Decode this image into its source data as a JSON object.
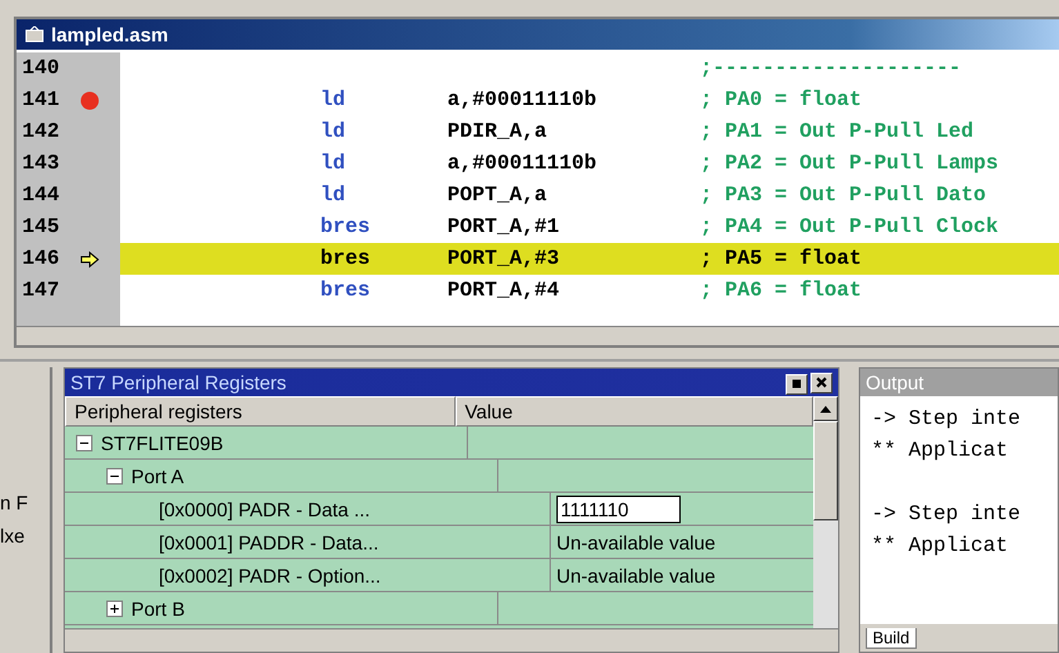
{
  "editor": {
    "title": "lampled.asm",
    "lines": [
      {
        "number": "140",
        "kind": "plain",
        "highlighted": false,
        "comment": ";--------------------"
      },
      {
        "number": "141",
        "kind": "breakpoint",
        "highlighted": false,
        "mnemonic": "ld",
        "operand": "a,#00011110b",
        "comment": "; PA0 = float"
      },
      {
        "number": "142",
        "kind": "plain",
        "highlighted": false,
        "mnemonic": "ld",
        "operand": "PDIR_A,a",
        "comment": "; PA1 = Out P-Pull Led"
      },
      {
        "number": "143",
        "kind": "plain",
        "highlighted": false,
        "mnemonic": "ld",
        "operand": "a,#00011110b",
        "comment": "; PA2 = Out P-Pull Lamps"
      },
      {
        "number": "144",
        "kind": "plain",
        "highlighted": false,
        "mnemonic": "ld",
        "operand": "POPT_A,a",
        "comment": "; PA3 = Out P-Pull Dato"
      },
      {
        "number": "145",
        "kind": "plain",
        "highlighted": false,
        "mnemonic": "bres",
        "operand": "PORT_A,#1",
        "comment": "; PA4 = Out P-Pull Clock"
      },
      {
        "number": "146",
        "kind": "current",
        "highlighted": true,
        "mnemonic": "bres",
        "operand": "PORT_A,#3",
        "comment": "; PA5 = float"
      },
      {
        "number": "147",
        "kind": "plain",
        "highlighted": false,
        "mnemonic": "bres",
        "operand": "PORT_A,#4",
        "comment": "; PA6 = float"
      }
    ]
  },
  "side_panel": {
    "texts": [
      "n F",
      "lxe"
    ]
  },
  "registers": {
    "title": "Peripheral Registers",
    "title_prefix": "ST7",
    "columns": [
      "Peripheral registers",
      "Value"
    ],
    "tree": [
      {
        "label": "ST7FLITE09B",
        "expanded": true,
        "children": [
          {
            "label": "Port A",
            "expanded": true,
            "children": [
              {
                "label": "[0x0000] PADR - Data ...",
                "value": "1111110",
                "editing": true
              },
              {
                "label": "[0x0001] PADDR - Data...",
                "value": "Un-available value",
                "editing": false
              },
              {
                "label": "[0x0002] PADR - Option...",
                "value": "Un-available value",
                "editing": false
              }
            ]
          },
          {
            "label": "Port B",
            "expanded": false
          }
        ]
      }
    ]
  },
  "output": {
    "title": "Output",
    "blocks": [
      {
        "lines": [
          "-> Step inte",
          "** Applicat"
        ]
      },
      {
        "lines": [
          "-> Step inte",
          "** Applicat"
        ]
      }
    ],
    "tabs": [
      {
        "label": "Build",
        "selected": true
      }
    ]
  }
}
